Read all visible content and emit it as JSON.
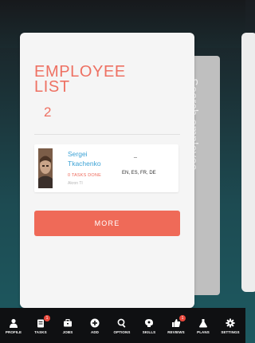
{
  "search": {
    "label": "Search employee"
  },
  "card": {
    "title_line1": "EMPLOYEE",
    "title_line2": "LIST",
    "count": "2"
  },
  "employee": {
    "name": "Sergei Tkachenko",
    "tasks": "0 TASKS DONE",
    "sub": "Akron TI",
    "dash": "_",
    "languages": "EN, ES, FR, DE"
  },
  "more_label": "MORE",
  "nav": [
    {
      "label": "PROFILE",
      "icon": "person-icon"
    },
    {
      "label": "TASKS",
      "icon": "clipboard-icon",
      "badge": "1"
    },
    {
      "label": "JOBS",
      "icon": "briefcase-icon"
    },
    {
      "label": "ADD",
      "icon": "plus-circle-icon"
    },
    {
      "label": "OPTIONS",
      "icon": "search-gear-icon"
    },
    {
      "label": "SKILLS",
      "icon": "brain-icon"
    },
    {
      "label": "REVIEWS",
      "icon": "thumbs-up-icon",
      "badge": "1"
    },
    {
      "label": "PLANS",
      "icon": "flask-icon"
    },
    {
      "label": "SETTINGS",
      "icon": "gear-icon"
    }
  ]
}
